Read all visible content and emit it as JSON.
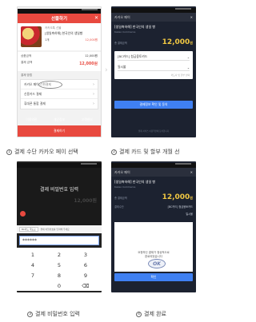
{
  "frame1": {
    "brand": "선물하기",
    "product_small": "카카오톡 선물",
    "product_name": "[생일축하해] 한국인의 생일빵",
    "qty": "1개",
    "product_price": "12,000원",
    "total_label": "상품금액",
    "total_value": "12,000원",
    "pay_label": "결제 금액",
    "pay_value": "12,000원",
    "method_title": "결제 방법",
    "methods": [
      "카카오 페이 간편결제",
      "신용카드 결제",
      "휴대폰 통합 결제"
    ],
    "footer_links": [
      "이용약관",
      "개인정보",
      "고객센터"
    ],
    "footer_btn": "결제하기"
  },
  "frame2": {
    "title": "카카오 페이",
    "close": "✕",
    "product": "[생일축하해] 한국인의 생일 빵",
    "merchant": "Kakao Commerce",
    "amount_label": "총 결제금액",
    "amount": "12,000",
    "amount_unit": "원",
    "card": "[BC카드] 청금융토카드",
    "installment": "일시불",
    "note": "카드사 및 할부 선택",
    "button": "결제정보 확인 및 동의",
    "bottom_note": "결제 서비스 이용약관에 동의합니다"
  },
  "frame3": {
    "title": "결제 비밀번호 입력",
    "ghost_amount": "12,000원",
    "tag": "BC카드 국토교",
    "hint": "결제 비밀번호를 입력해 주세요",
    "pin": "******",
    "keys": [
      [
        "1",
        "2",
        "3"
      ],
      [
        "4",
        "5",
        "6"
      ],
      [
        "7",
        "8",
        "9"
      ],
      [
        "",
        "0",
        "⌫"
      ]
    ],
    "button": "확인"
  },
  "frame4": {
    "title": "카카오 페이",
    "close": "✕",
    "product": "[생일축하해] 한국인의 생일 빵",
    "merchant": "Kakao Commerce",
    "amount_label": "총 결제금액",
    "amount": "12,000",
    "amount_unit": "원",
    "card_label": "결제수단",
    "card": "[BC카드] 청금융토카드",
    "installment": "일시불",
    "done_text_1": "요청하신 결제가 정상적으로",
    "done_text_2": "완료되었습니다",
    "ok": "OK",
    "button": "확인"
  },
  "captions": [
    {
      "num": "1",
      "text": "결제 수단 카카오 페이 선택"
    },
    {
      "num": "2",
      "text": "결제 카드 및 할부 개월 선"
    },
    {
      "num": "3",
      "text": "결제 비밀번호 입력"
    },
    {
      "num": "4",
      "text": "결제 완료"
    }
  ],
  "colors": {
    "kakao_red": "#e8493f",
    "pay_blue": "#3f80f2",
    "dark_bg": "#1c2230",
    "amount_yellow": "#f1c842"
  }
}
